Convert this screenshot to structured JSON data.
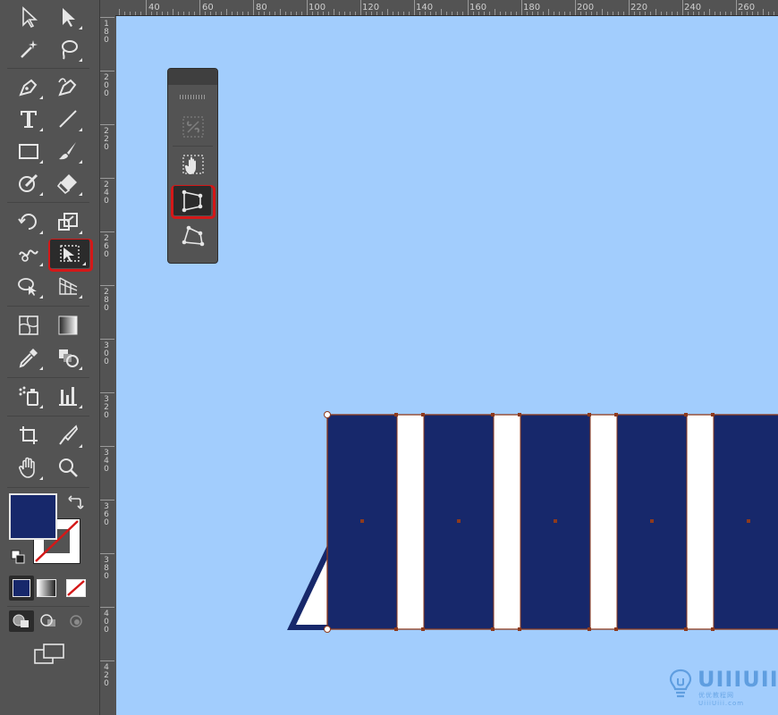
{
  "ruler": {
    "top_labels": [
      "40",
      "60",
      "80",
      "100",
      "120",
      "140",
      "160",
      "180",
      "200",
      "220",
      "240",
      "260"
    ],
    "left_labels": [
      "180",
      "200",
      "220",
      "240",
      "260",
      "280",
      "300",
      "320",
      "340",
      "360",
      "380",
      "400",
      "420"
    ]
  },
  "tools": {
    "selection": "selection-tool",
    "direct_selection": "direct-selection-tool",
    "magic_wand": "magic-wand-tool",
    "lasso": "lasso-tool",
    "pen": "pen-tool",
    "curvature": "curvature-tool",
    "type": "type-tool",
    "line": "line-segment-tool",
    "rectangle": "rectangle-tool",
    "paintbrush": "paintbrush-tool",
    "shaper": "shaper-tool",
    "eraser": "eraser-tool",
    "rotate": "rotate-tool",
    "scale": "scale-tool",
    "warp": "warp-tool",
    "free_transform": "free-transform-tool",
    "shape_builder": "shape-builder-tool",
    "perspective": "perspective-grid-tool",
    "mesh": "mesh-tool",
    "gradient": "gradient-tool",
    "eyedropper": "eyedropper-tool",
    "blend": "blend-tool",
    "symbol_sprayer": "symbol-sprayer-tool",
    "graph": "column-graph-tool",
    "artboard": "artboard-tool",
    "slice": "slice-tool",
    "hand": "hand-tool",
    "zoom": "zoom-tool"
  },
  "colors": {
    "fill": "#17286b",
    "stroke": "none",
    "canvas": "#a2cdfd",
    "highlight": "#d41818",
    "stripe_dark": "#17286b",
    "stripe_light": "#ffffff"
  },
  "free_transform_panel": {
    "options": [
      "constrain",
      "free-transform",
      "perspective-distort",
      "free-distort"
    ],
    "selected": "perspective-distort"
  },
  "watermark": {
    "text": "UIIIUIII",
    "subtitle": "优优教程网 UiiiUiii.com"
  }
}
